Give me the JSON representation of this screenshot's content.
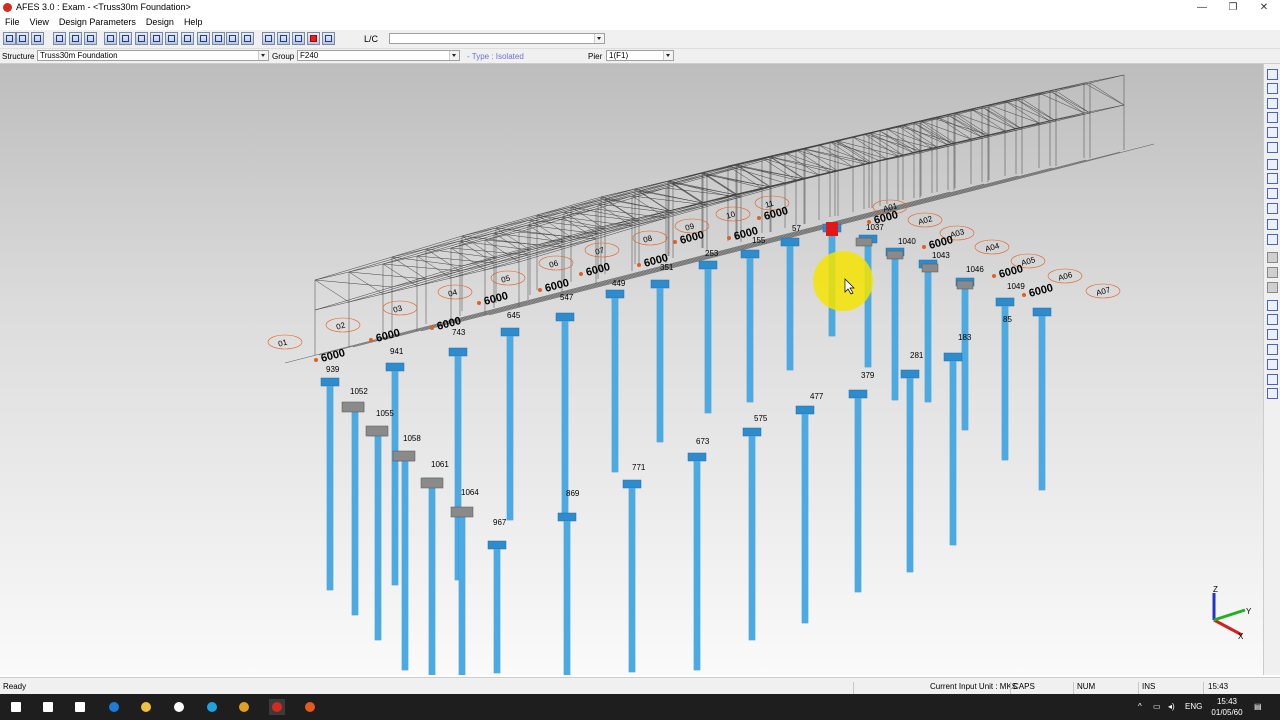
{
  "window": {
    "title": "AFES 3.0 : Exam - <Truss30m Foundation>",
    "minimize": "—",
    "maximize": "❐",
    "close": "✕"
  },
  "menu": [
    "File",
    "View",
    "Design Parameters",
    "Design",
    "Help"
  ],
  "toolbar": {
    "lc_label": "L/C",
    "lc_value": "",
    "icons": [
      "new-icon",
      "open-icon",
      "save-icon",
      "copy-icon",
      "grid-icon",
      "node-icon",
      "member-icon",
      "delete-icon",
      "table-icon",
      "frame-icon",
      "truss-icon",
      "support-icon",
      "pile-icon",
      "lock-icon",
      "load-icon",
      "view-icon",
      "render-icon",
      "export-icon",
      "report-icon",
      "flag-icon",
      "back-icon"
    ]
  },
  "selection": {
    "structure_label": "Structure",
    "structure_value": "Truss30m Foundation",
    "group_label": "Group",
    "group_value": "F240",
    "type_text": "- Type : Isolated",
    "pier_label": "Pier",
    "pier_value": "1(F1)"
  },
  "model": {
    "grid_labels": [
      "01",
      "02",
      "03",
      "04",
      "05",
      "06",
      "07",
      "08",
      "09",
      "10",
      "11",
      "A01",
      "A02",
      "A03",
      "A04",
      "A05",
      "A06",
      "A07"
    ],
    "dims": [
      "6000",
      "6000",
      "6000",
      "6000",
      "6000",
      "6000",
      "6000",
      "6000",
      "6000",
      "6000",
      "6000",
      "6000",
      "6000",
      "6000"
    ],
    "node_labels": [
      "939",
      "1052",
      "1055",
      "1058",
      "1061",
      "1064",
      "967",
      "941",
      "743",
      "645",
      "547",
      "449",
      "351",
      "253",
      "155",
      "57",
      "1037",
      "1040",
      "1043",
      "1046",
      "1049",
      "85",
      "183",
      "281",
      "379",
      "477",
      "575",
      "673",
      "771",
      "869"
    ]
  },
  "axes": {
    "z": "Z",
    "y": "Y",
    "x": "X"
  },
  "status": {
    "ready": "Ready",
    "unit": "Current Input Unit : MKS",
    "caps": "CAPS",
    "num": "NUM",
    "ins": "INS",
    "time": "15:43"
  },
  "taskbar": {
    "tray_lang": "ENG",
    "clock_time": "15:43",
    "clock_date": "01/05/60",
    "apps": [
      "start-icon",
      "search-icon",
      "task-view-icon",
      "edge-icon",
      "file-explorer-icon",
      "store-icon",
      "skype-icon",
      "chrome-icon",
      "afes-icon",
      "office-icon"
    ]
  }
}
